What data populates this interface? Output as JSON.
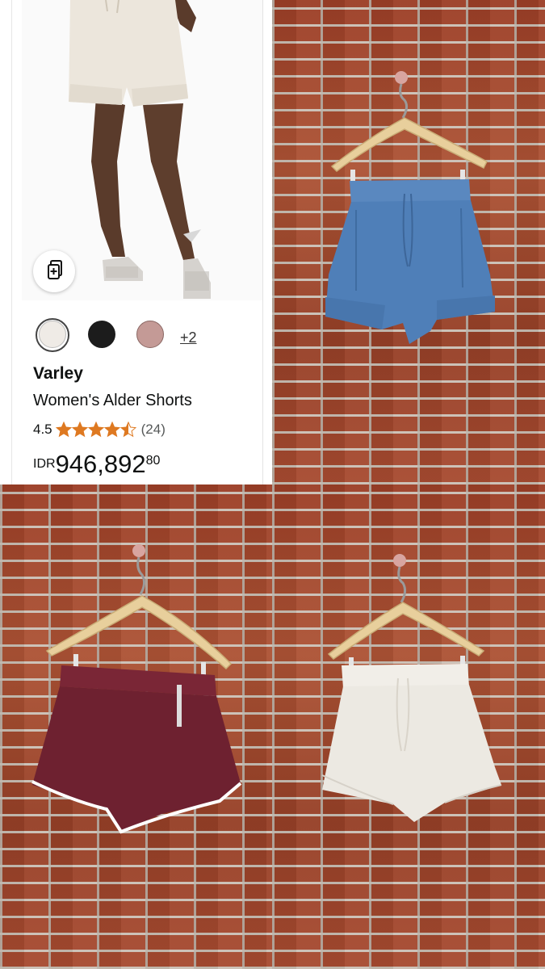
{
  "product": {
    "color_options": [
      {
        "name": "cream",
        "color": "#efebe6"
      },
      {
        "name": "black",
        "color": "#1c1c1c"
      },
      {
        "name": "mauve",
        "color": "#c49a96"
      }
    ],
    "more_colors_label": "+2",
    "brand": "Varley",
    "title": "Women's Alder Shorts",
    "rating": "4.5",
    "rating_count": "(24)",
    "stars": 4.5,
    "price": {
      "currency": "IDR",
      "whole": "946,892",
      "fraction": "80"
    }
  },
  "colors": {
    "star": "#de7921",
    "blue_shorts": "#4f7fb8",
    "burgundy_shorts": "#6e2130",
    "cream_shorts": "#ece9e2",
    "brick": "#a0452c"
  },
  "icons": [
    "share-icon"
  ]
}
